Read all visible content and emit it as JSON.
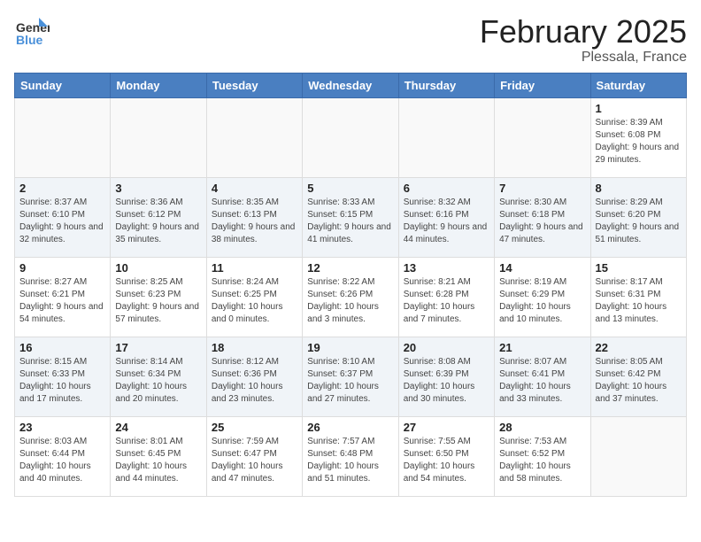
{
  "header": {
    "logo_general": "General",
    "logo_blue": "Blue",
    "month": "February 2025",
    "location": "Plessala, France"
  },
  "weekdays": [
    "Sunday",
    "Monday",
    "Tuesday",
    "Wednesday",
    "Thursday",
    "Friday",
    "Saturday"
  ],
  "weeks": [
    [
      {
        "day": "",
        "detail": ""
      },
      {
        "day": "",
        "detail": ""
      },
      {
        "day": "",
        "detail": ""
      },
      {
        "day": "",
        "detail": ""
      },
      {
        "day": "",
        "detail": ""
      },
      {
        "day": "",
        "detail": ""
      },
      {
        "day": "1",
        "detail": "Sunrise: 8:39 AM\nSunset: 6:08 PM\nDaylight: 9 hours and 29 minutes."
      }
    ],
    [
      {
        "day": "2",
        "detail": "Sunrise: 8:37 AM\nSunset: 6:10 PM\nDaylight: 9 hours and 32 minutes."
      },
      {
        "day": "3",
        "detail": "Sunrise: 8:36 AM\nSunset: 6:12 PM\nDaylight: 9 hours and 35 minutes."
      },
      {
        "day": "4",
        "detail": "Sunrise: 8:35 AM\nSunset: 6:13 PM\nDaylight: 9 hours and 38 minutes."
      },
      {
        "day": "5",
        "detail": "Sunrise: 8:33 AM\nSunset: 6:15 PM\nDaylight: 9 hours and 41 minutes."
      },
      {
        "day": "6",
        "detail": "Sunrise: 8:32 AM\nSunset: 6:16 PM\nDaylight: 9 hours and 44 minutes."
      },
      {
        "day": "7",
        "detail": "Sunrise: 8:30 AM\nSunset: 6:18 PM\nDaylight: 9 hours and 47 minutes."
      },
      {
        "day": "8",
        "detail": "Sunrise: 8:29 AM\nSunset: 6:20 PM\nDaylight: 9 hours and 51 minutes."
      }
    ],
    [
      {
        "day": "9",
        "detail": "Sunrise: 8:27 AM\nSunset: 6:21 PM\nDaylight: 9 hours and 54 minutes."
      },
      {
        "day": "10",
        "detail": "Sunrise: 8:25 AM\nSunset: 6:23 PM\nDaylight: 9 hours and 57 minutes."
      },
      {
        "day": "11",
        "detail": "Sunrise: 8:24 AM\nSunset: 6:25 PM\nDaylight: 10 hours and 0 minutes."
      },
      {
        "day": "12",
        "detail": "Sunrise: 8:22 AM\nSunset: 6:26 PM\nDaylight: 10 hours and 3 minutes."
      },
      {
        "day": "13",
        "detail": "Sunrise: 8:21 AM\nSunset: 6:28 PM\nDaylight: 10 hours and 7 minutes."
      },
      {
        "day": "14",
        "detail": "Sunrise: 8:19 AM\nSunset: 6:29 PM\nDaylight: 10 hours and 10 minutes."
      },
      {
        "day": "15",
        "detail": "Sunrise: 8:17 AM\nSunset: 6:31 PM\nDaylight: 10 hours and 13 minutes."
      }
    ],
    [
      {
        "day": "16",
        "detail": "Sunrise: 8:15 AM\nSunset: 6:33 PM\nDaylight: 10 hours and 17 minutes."
      },
      {
        "day": "17",
        "detail": "Sunrise: 8:14 AM\nSunset: 6:34 PM\nDaylight: 10 hours and 20 minutes."
      },
      {
        "day": "18",
        "detail": "Sunrise: 8:12 AM\nSunset: 6:36 PM\nDaylight: 10 hours and 23 minutes."
      },
      {
        "day": "19",
        "detail": "Sunrise: 8:10 AM\nSunset: 6:37 PM\nDaylight: 10 hours and 27 minutes."
      },
      {
        "day": "20",
        "detail": "Sunrise: 8:08 AM\nSunset: 6:39 PM\nDaylight: 10 hours and 30 minutes."
      },
      {
        "day": "21",
        "detail": "Sunrise: 8:07 AM\nSunset: 6:41 PM\nDaylight: 10 hours and 33 minutes."
      },
      {
        "day": "22",
        "detail": "Sunrise: 8:05 AM\nSunset: 6:42 PM\nDaylight: 10 hours and 37 minutes."
      }
    ],
    [
      {
        "day": "23",
        "detail": "Sunrise: 8:03 AM\nSunset: 6:44 PM\nDaylight: 10 hours and 40 minutes."
      },
      {
        "day": "24",
        "detail": "Sunrise: 8:01 AM\nSunset: 6:45 PM\nDaylight: 10 hours and 44 minutes."
      },
      {
        "day": "25",
        "detail": "Sunrise: 7:59 AM\nSunset: 6:47 PM\nDaylight: 10 hours and 47 minutes."
      },
      {
        "day": "26",
        "detail": "Sunrise: 7:57 AM\nSunset: 6:48 PM\nDaylight: 10 hours and 51 minutes."
      },
      {
        "day": "27",
        "detail": "Sunrise: 7:55 AM\nSunset: 6:50 PM\nDaylight: 10 hours and 54 minutes."
      },
      {
        "day": "28",
        "detail": "Sunrise: 7:53 AM\nSunset: 6:52 PM\nDaylight: 10 hours and 58 minutes."
      },
      {
        "day": "",
        "detail": ""
      }
    ]
  ]
}
